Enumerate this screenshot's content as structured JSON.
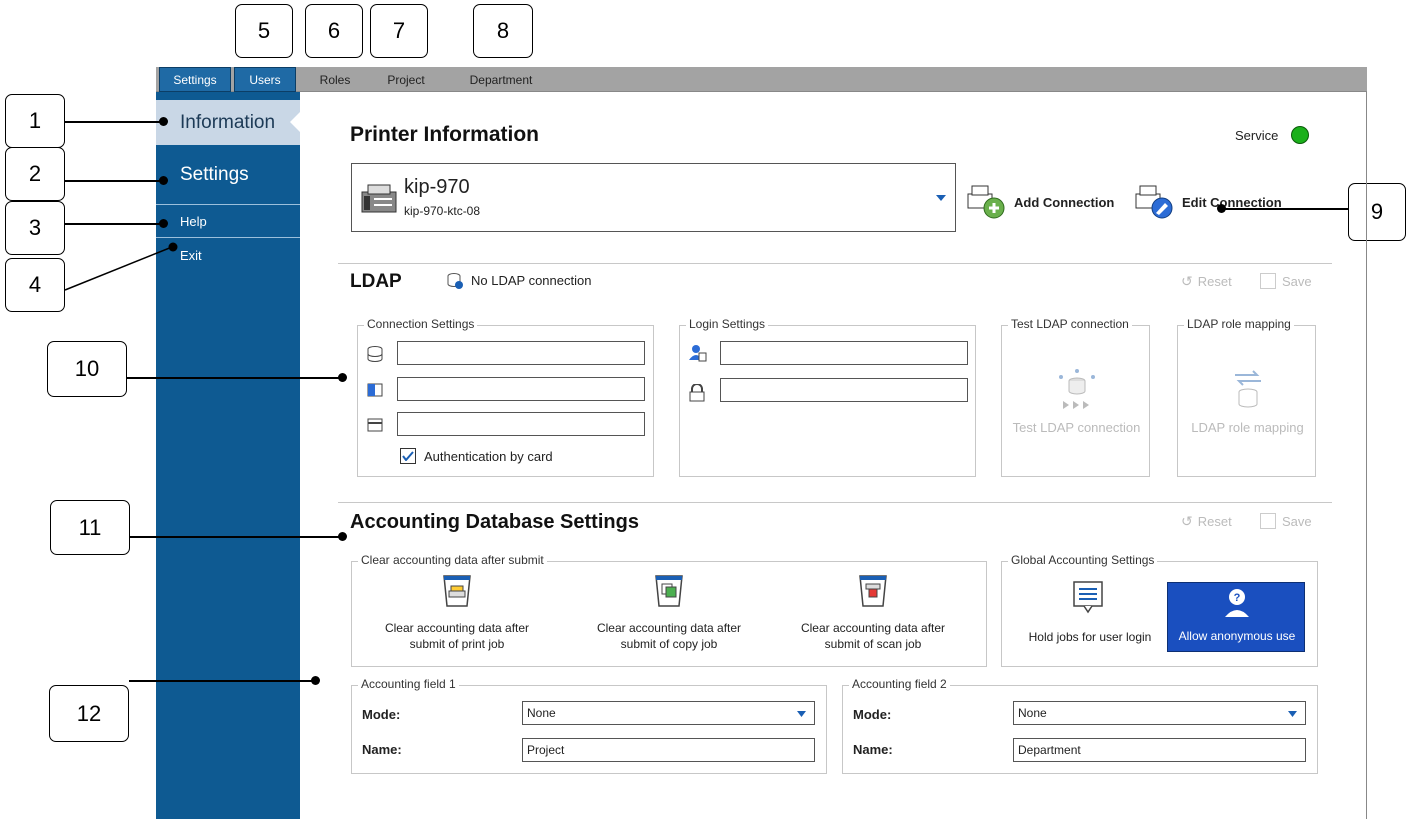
{
  "callouts": [
    "1",
    "2",
    "3",
    "4",
    "5",
    "6",
    "7",
    "8",
    "9",
    "10",
    "11",
    "12"
  ],
  "tabs": [
    "Settings",
    "Users",
    "Roles",
    "Project",
    "Department"
  ],
  "sidebar": {
    "information": "Information",
    "settings": "Settings",
    "help": "Help",
    "exit": "Exit"
  },
  "printer": {
    "title": "Printer Information",
    "service_label": "Service",
    "service_color": "#1bb01b",
    "name": "kip-970",
    "host": "kip-970-ktc-08",
    "add_connection": "Add Connection",
    "edit_connection": "Edit Connection"
  },
  "ldap": {
    "title": "LDAP",
    "status": "No LDAP connection",
    "reset": "Reset",
    "save": "Save",
    "connection_settings": "Connection Settings",
    "auth_by_card": "Authentication by card",
    "auth_by_card_checked": true,
    "login_settings": "Login Settings",
    "test_group": "Test LDAP connection",
    "test_button": "Test LDAP connection",
    "role_group": "LDAP role mapping",
    "role_button": "LDAP role mapping"
  },
  "accounting": {
    "title": "Accounting Database Settings",
    "reset": "Reset",
    "save": "Save",
    "clear_group": "Clear accounting data after submit",
    "clear_print": [
      "Clear accounting data after",
      "submit of print job"
    ],
    "clear_copy": [
      "Clear accounting data after",
      "submit of copy job"
    ],
    "clear_scan": [
      "Clear accounting data after",
      "submit of scan job"
    ],
    "global_group": "Global Accounting Settings",
    "hold_jobs": "Hold jobs for user login",
    "anonymous": "Allow anonymous use",
    "field1": {
      "legend": "Accounting field 1",
      "mode_label": "Mode:",
      "mode_value": "None",
      "name_label": "Name:",
      "name_value": "Project"
    },
    "field2": {
      "legend": "Accounting field 2",
      "mode_label": "Mode:",
      "mode_value": "None",
      "name_label": "Name:",
      "name_value": "Department"
    }
  },
  "colors": {
    "accent": "#0e5a92",
    "selected": "#1a4fbf",
    "tabbar": "#a3a3a3"
  }
}
